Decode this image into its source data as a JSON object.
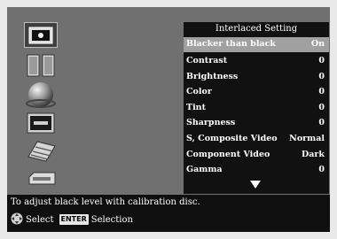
{
  "icons": [
    {
      "name": "settings-screen-icon",
      "selected": true
    },
    {
      "name": "speakers-icon",
      "selected": false
    },
    {
      "name": "globe-icon",
      "selected": false
    },
    {
      "name": "tv-monitor-icon",
      "selected": false
    },
    {
      "name": "keyboard-icon",
      "selected": false
    },
    {
      "name": "device-icon",
      "selected": false
    }
  ],
  "menu": {
    "title": "Interlaced Setting",
    "items": [
      {
        "label": "Blacker than black",
        "value": "On",
        "selected": true
      },
      {
        "label": "Contrast",
        "value": "0"
      },
      {
        "label": "Brightness",
        "value": "0"
      },
      {
        "label": "Color",
        "value": "0"
      },
      {
        "label": "Tint",
        "value": "0"
      },
      {
        "label": "Sharpness",
        "value": "0"
      },
      {
        "label": "S, Composite Video",
        "value": "Normal"
      },
      {
        "label": "Component Video",
        "value": "Dark"
      },
      {
        "label": "Gamma",
        "value": "0"
      }
    ],
    "more_indicator": "down-arrow-icon"
  },
  "help": {
    "description": "To adjust black level with calibration disc.",
    "select_label": "Select",
    "enter_key": "ENTER",
    "enter_label": "Selection"
  },
  "colors": {
    "frame": "#707070",
    "panel": "#111111",
    "highlight": "#a0a0a0",
    "text": "#ffffff"
  }
}
